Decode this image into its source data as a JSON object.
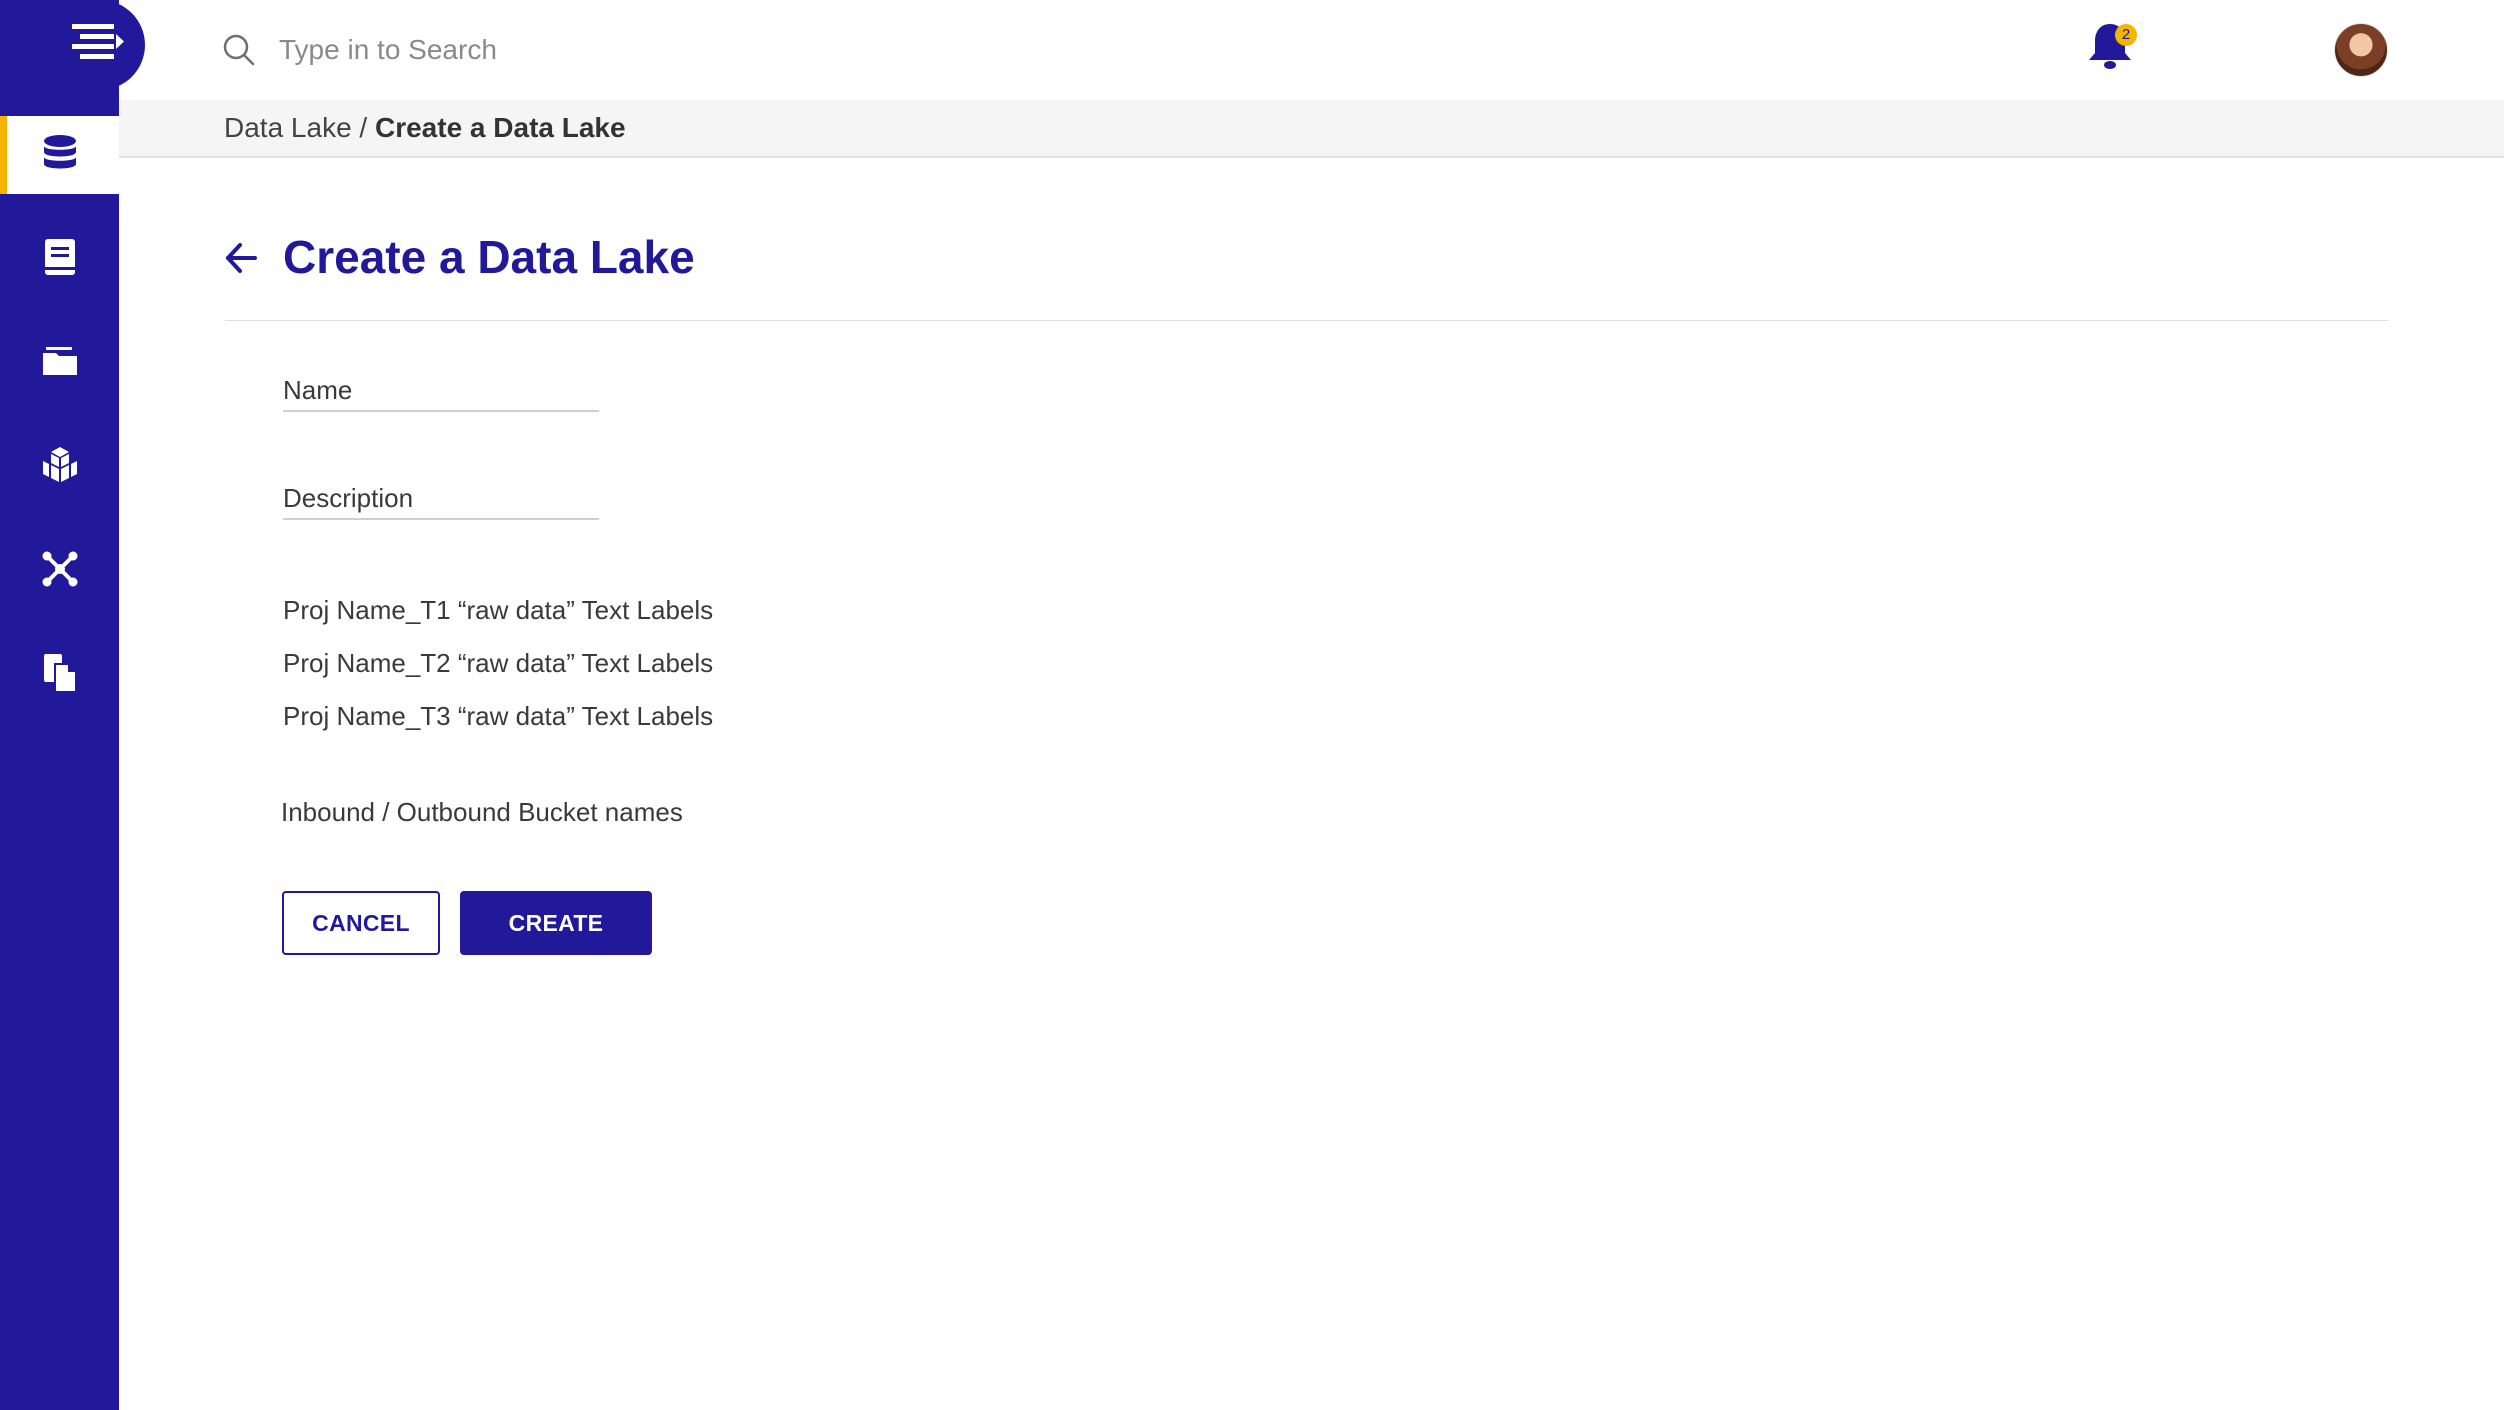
{
  "search": {
    "placeholder": "Type in to Search"
  },
  "notifications": {
    "count": "2"
  },
  "sidebar": {
    "items": [
      {
        "name": "database",
        "icon": "database-icon",
        "active": true
      },
      {
        "name": "book",
        "icon": "book-icon",
        "active": false
      },
      {
        "name": "folder",
        "icon": "folder-icon",
        "active": false
      },
      {
        "name": "cubes",
        "icon": "cubes-icon",
        "active": false
      },
      {
        "name": "network",
        "icon": "network-icon",
        "active": false
      },
      {
        "name": "copy",
        "icon": "copy-icon",
        "active": false
      }
    ]
  },
  "breadcrumb": {
    "parent": "Data Lake",
    "separator": "/",
    "current": "Create a Data Lake"
  },
  "page": {
    "title": "Create a Data Lake"
  },
  "form": {
    "name_placeholder": "Name",
    "description_placeholder": "Description",
    "labels": [
      "Proj Name_T1 “raw data” Text Labels",
      "Proj Name_T2 “raw data” Text Labels",
      "Proj Name_T3 “raw data” Text Labels"
    ],
    "buckets_label": "Inbound / Outbound Bucket names"
  },
  "actions": {
    "cancel": "CANCEL",
    "create": "CREATE"
  },
  "colors": {
    "primary": "#22199a",
    "accent": "#f5b400",
    "background": "#ffffff"
  }
}
